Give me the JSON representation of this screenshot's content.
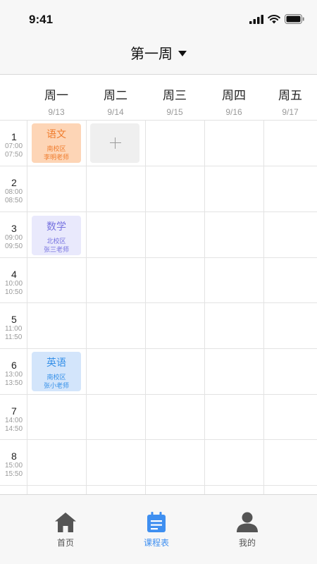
{
  "status_bar": {
    "time": "9:41"
  },
  "header": {
    "week_label": "第一周"
  },
  "days": [
    {
      "name": "周一",
      "date": "9/13"
    },
    {
      "name": "周二",
      "date": "9/14"
    },
    {
      "name": "周三",
      "date": "9/15"
    },
    {
      "name": "周四",
      "date": "9/16"
    },
    {
      "name": "周五",
      "date": "9/17"
    }
  ],
  "periods": [
    {
      "num": "1",
      "start": "07:00",
      "end": "07:50"
    },
    {
      "num": "2",
      "start": "08:00",
      "end": "08:50"
    },
    {
      "num": "3",
      "start": "09:00",
      "end": "09:50"
    },
    {
      "num": "4",
      "start": "10:00",
      "end": "10:50"
    },
    {
      "num": "5",
      "start": "11:00",
      "end": "11:50"
    },
    {
      "num": "6",
      "start": "13:00",
      "end": "13:50"
    },
    {
      "num": "7",
      "start": "14:00",
      "end": "14:50"
    },
    {
      "num": "8",
      "start": "15:00",
      "end": "15:50"
    }
  ],
  "courses": [
    {
      "name": "语文",
      "campus": "南校区",
      "teacher": "李明老师",
      "day": "周一",
      "period": "1",
      "bg": "#fdd5b6",
      "color": "#f07c2c"
    },
    {
      "name": "数学",
      "campus": "北校区",
      "teacher": "张三老师",
      "day": "周一",
      "period": "3",
      "bg": "#e9e9fc",
      "color": "#7773e0"
    },
    {
      "name": "英语",
      "campus": "南校区",
      "teacher": "张小老师",
      "day": "周一",
      "period": "6",
      "bg": "#d3e5fb",
      "color": "#3590e8"
    }
  ],
  "add_slot": {
    "icon": "plus-icon",
    "day": "周二",
    "period": "1"
  },
  "tabs": [
    {
      "label": "首页",
      "icon": "home-icon",
      "active": false
    },
    {
      "label": "课程表",
      "icon": "calendar-icon",
      "active": true
    },
    {
      "label": "我的",
      "icon": "user-icon",
      "active": false
    }
  ],
  "colors": {
    "accent": "#3f8ff0",
    "tab_inactive": "#555555"
  }
}
